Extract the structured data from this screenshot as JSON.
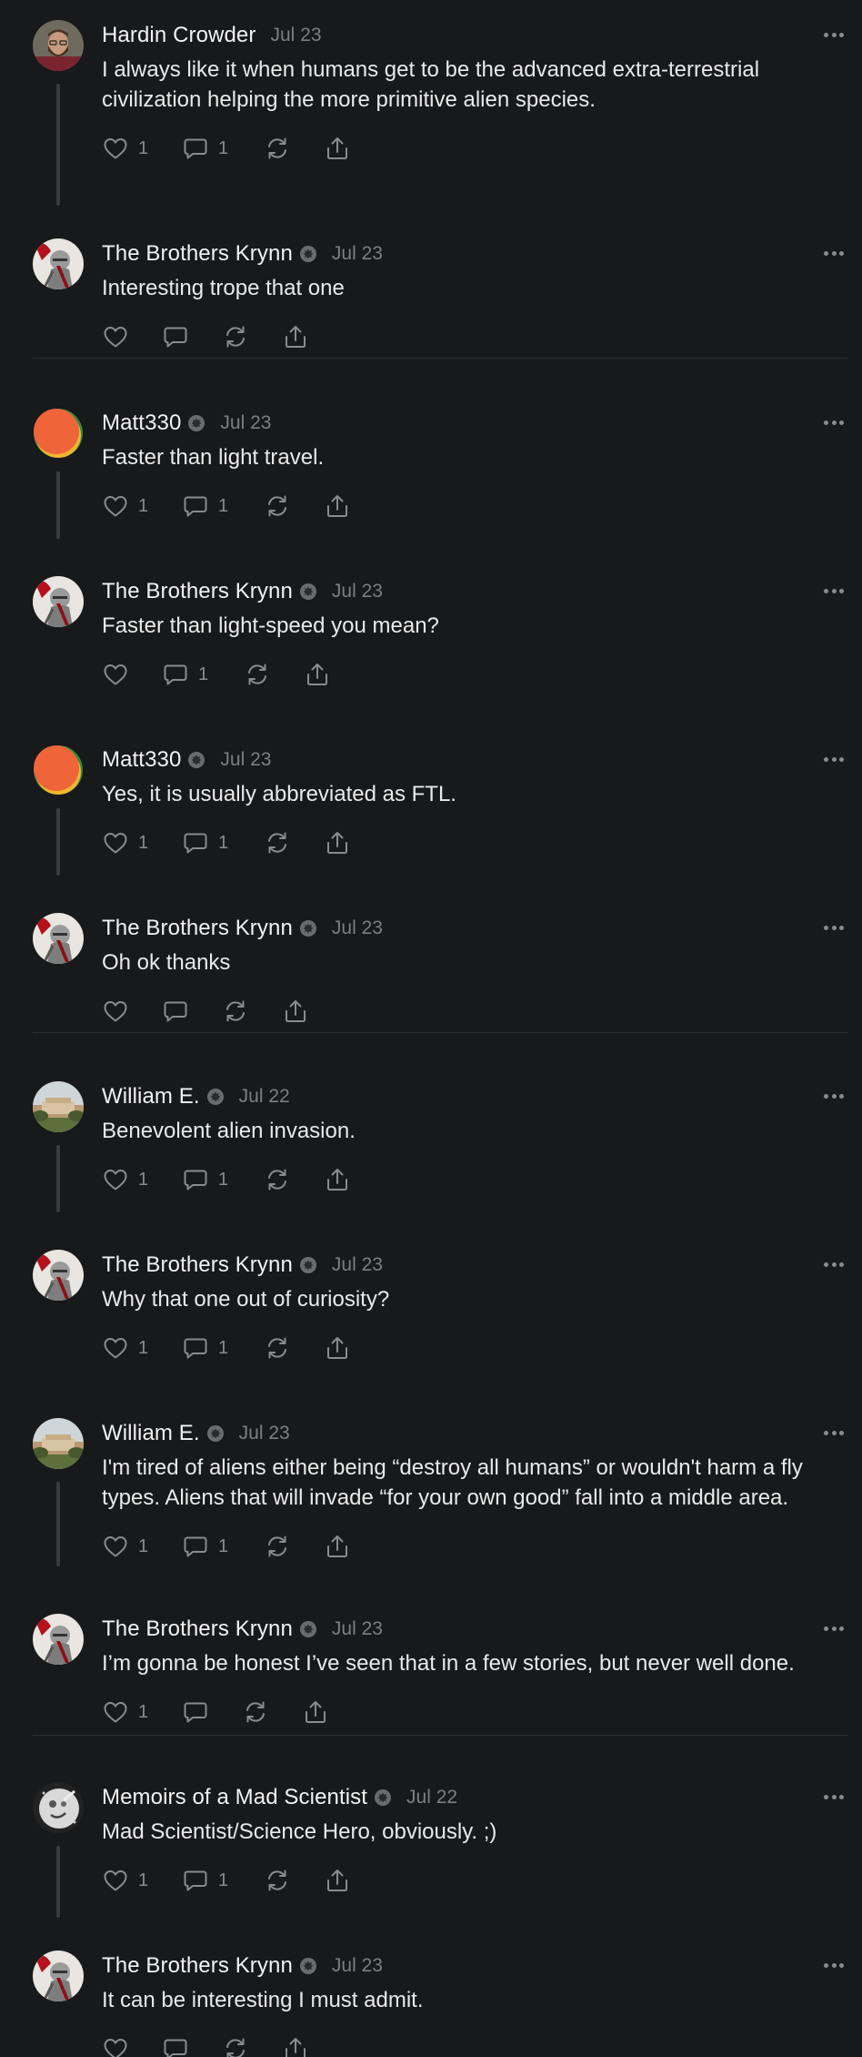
{
  "colors": {
    "background": "#18191b",
    "text": "#e9e9e9",
    "muted": "#7d7e82",
    "icon": "#8a8b8f",
    "thread_line": "#3a3b3e",
    "divider": "#2e2f32"
  },
  "posts": [
    {
      "author": "Hardin Crowder",
      "verified": false,
      "date": "Jul 23",
      "avatar": "avatar-bearded-man",
      "lines": [
        "I always like it when humans get to be the advanced extra-terrestrial",
        "civilization helping the more primitive alien species."
      ],
      "likes": "1",
      "replies": "1"
    },
    {
      "author": "The Brothers Krynn",
      "verified": true,
      "date": "Jul 23",
      "avatar": "avatar-knight",
      "lines": [
        "Interesting trope that one"
      ],
      "likes": "",
      "replies": ""
    },
    {
      "author": "Matt330",
      "verified": true,
      "date": "Jul 23",
      "avatar": "avatar-orange-circle",
      "lines": [
        "Faster than light travel."
      ],
      "likes": "1",
      "replies": "1"
    },
    {
      "author": "The Brothers Krynn",
      "verified": true,
      "date": "Jul 23",
      "avatar": "avatar-knight",
      "lines": [
        "Faster than light-speed you mean?"
      ],
      "likes": "",
      "replies": "1"
    },
    {
      "author": "Matt330",
      "verified": true,
      "date": "Jul 23",
      "avatar": "avatar-orange-circle",
      "lines": [
        "Yes, it is usually abbreviated as FTL."
      ],
      "likes": "1",
      "replies": "1"
    },
    {
      "author": "The Brothers Krynn",
      "verified": true,
      "date": "Jul 23",
      "avatar": "avatar-knight",
      "lines": [
        "Oh ok thanks"
      ],
      "likes": "",
      "replies": ""
    },
    {
      "author": "William E.",
      "verified": true,
      "date": "Jul 22",
      "avatar": "avatar-landscape",
      "lines": [
        "Benevolent alien invasion."
      ],
      "likes": "1",
      "replies": "1"
    },
    {
      "author": "The Brothers Krynn",
      "verified": true,
      "date": "Jul 23",
      "avatar": "avatar-knight",
      "lines": [
        "Why that one out of curiosity?"
      ],
      "likes": "1",
      "replies": "1"
    },
    {
      "author": "William E.",
      "verified": true,
      "date": "Jul 23",
      "avatar": "avatar-landscape",
      "lines": [
        "I'm tired of aliens either being “destroy all humans” or wouldn't harm a fly",
        "types. Aliens that will invade “for your own good” fall into a middle area."
      ],
      "likes": "1",
      "replies": "1"
    },
    {
      "author": "The Brothers Krynn",
      "verified": true,
      "date": "Jul 23",
      "avatar": "avatar-knight",
      "lines": [
        "I’m gonna be honest I’ve seen that in a few stories, but never well done."
      ],
      "likes": "1",
      "replies": ""
    },
    {
      "author": "Memoirs of a Mad Scientist",
      "verified": true,
      "date": "Jul 22",
      "avatar": "avatar-moon-face",
      "lines": [
        "Mad Scientist/Science Hero, obviously. ;)"
      ],
      "likes": "1",
      "replies": "1"
    },
    {
      "author": "The Brothers Krynn",
      "verified": true,
      "date": "Jul 23",
      "avatar": "avatar-knight",
      "lines": [
        "It can be interesting I must admit."
      ],
      "likes": "",
      "replies": ""
    }
  ]
}
